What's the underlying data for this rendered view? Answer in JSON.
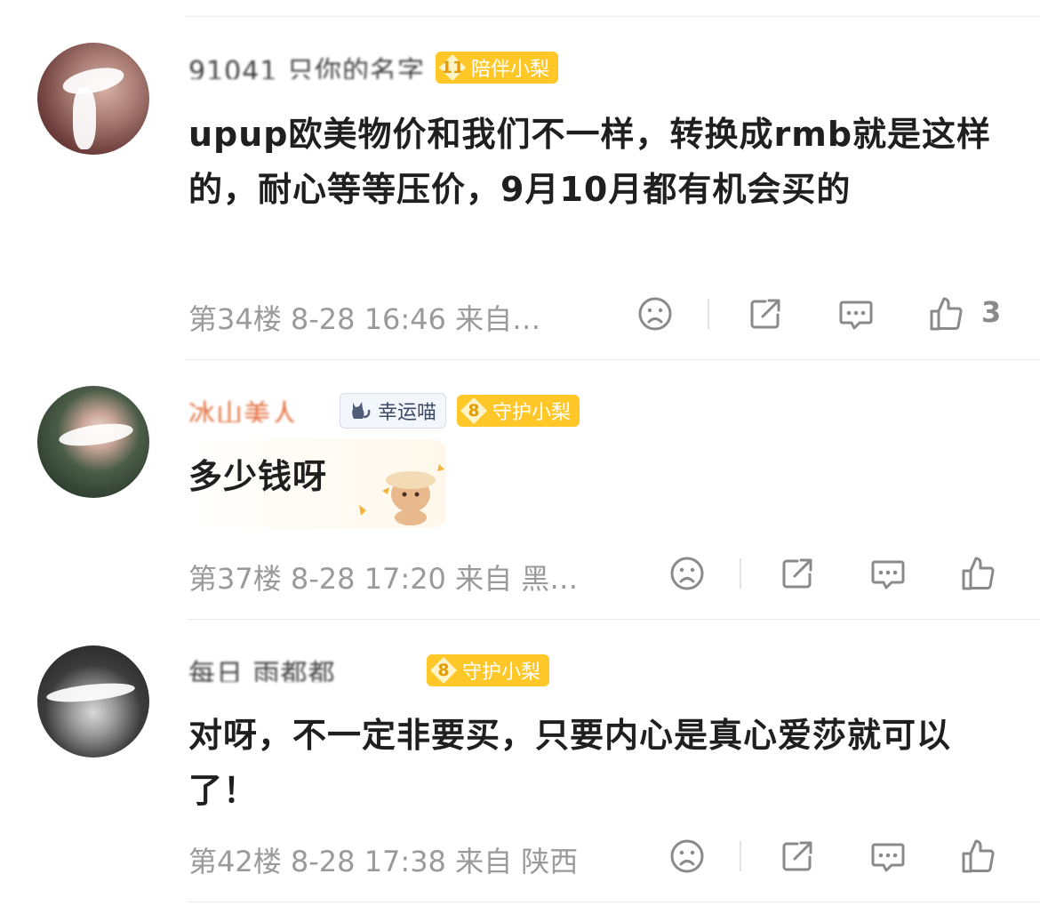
{
  "comments": [
    {
      "username": "91041 只你的名字",
      "badge": {
        "level": "11",
        "label": "陪伴小梨"
      },
      "text": "upup欧美物价和我们不一样，转换成rmb就是这样的，耐心等等压价，9月10月都有机会买的",
      "meta": "第34楼 8-28 16:46 来自…",
      "like_count": "3"
    },
    {
      "username": "冰山美人",
      "tag": {
        "label": "幸运喵"
      },
      "badge": {
        "level": "8",
        "label": "守护小梨"
      },
      "text": "多少钱呀",
      "meta": "第37楼 8-28 17:20 来自 黑…",
      "like_count": ""
    },
    {
      "username": "每日 雨都都",
      "badge": {
        "level": "8",
        "label": "守护小梨"
      },
      "text": "对呀，不一定非要买，只要内心是真心爱莎就可以了！",
      "meta": "第42楼 8-28 17:38 来自 陕西",
      "like_count": ""
    }
  ],
  "icons": {
    "dislike": "sad-face-icon",
    "share": "share-icon",
    "reply": "comment-icon",
    "like": "thumbs-up-icon"
  },
  "colors": {
    "badge": "#ffc828",
    "meta": "#9a9a9a",
    "icon": "#8a8a8a"
  }
}
